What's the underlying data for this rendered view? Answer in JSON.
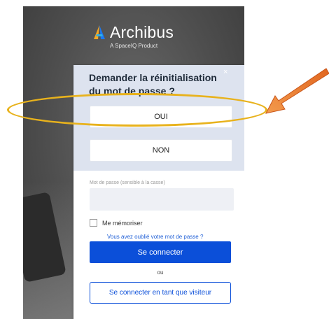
{
  "branding": {
    "app_name": "Archibus",
    "tagline": "A SpaceIQ Product",
    "logo_colors": [
      "#f7a823",
      "#1c79f1",
      "#2fb3e8"
    ]
  },
  "dialog": {
    "title": "Demander la réinitialisation du mot de passe ?",
    "close_label": "×",
    "yes_label": "OUI",
    "no_label": "NON"
  },
  "login": {
    "password_label": "Mot de passe (sensible à la casse)",
    "password_value": "",
    "remember_label": "Me mémoriser",
    "remember_checked": false,
    "forgot_link": "Vous avez oublié votre mot de passe ?",
    "login_button": "Se connecter",
    "or_text": "ou",
    "guest_button": "Se connecter en tant que visiteur"
  },
  "annotation": {
    "highlight_color": "#e8b21c",
    "arrow_color": "#e9782a"
  }
}
